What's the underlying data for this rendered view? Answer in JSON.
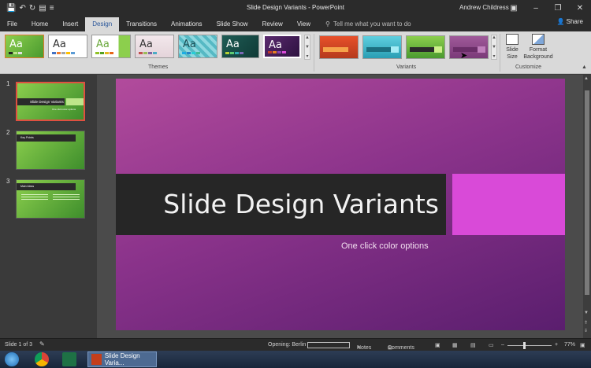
{
  "window": {
    "title": "Slide Design Variants - PowerPoint",
    "user": "Andrew Childress",
    "share_label": "Share"
  },
  "tabs": [
    "File",
    "Home",
    "Insert",
    "Design",
    "Transitions",
    "Animations",
    "Slide Show",
    "Review",
    "View"
  ],
  "active_tab": "Design",
  "tell_me": "Tell me what you want to do",
  "ribbon": {
    "themes_label": "Themes",
    "variants_label": "Variants",
    "customize_label": "Customize",
    "theme_glyph": "Aa",
    "slide_size_label": "Slide Size",
    "format_background_label": "Format Background"
  },
  "slides_pane": {
    "numbers": [
      "1",
      "2",
      "3"
    ],
    "slide1_title": "Slide Design Variants",
    "slide1_sub": "One click color options",
    "slide2_title": "Key Points",
    "slide3_title": "Main Ideas"
  },
  "slide": {
    "title": "Slide Design Variants",
    "subtitle": "One click color options"
  },
  "status": {
    "slide_count": "Slide 1 of 3",
    "opening": "Opening: Berlin",
    "notes": "Notes",
    "comments": "Comments",
    "zoom": "77%"
  },
  "taskbar": {
    "active_app": "Slide Design Varia..."
  },
  "colors": {
    "accent": "#2b579a",
    "slide_magenta": "#d94ad8",
    "thumb_green": "#8ccf4d"
  }
}
